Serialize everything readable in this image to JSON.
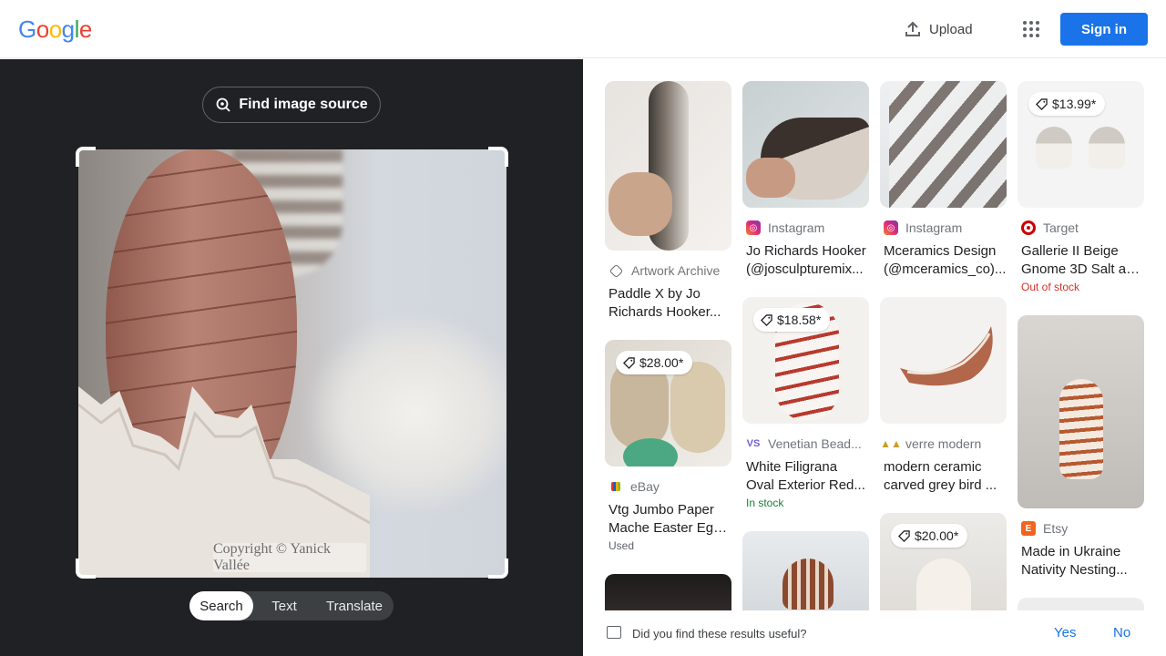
{
  "header": {
    "logo_letters": [
      {
        "ch": "G",
        "color": "#4285F4"
      },
      {
        "ch": "o",
        "color": "#EA4335"
      },
      {
        "ch": "o",
        "color": "#FBBC05"
      },
      {
        "ch": "g",
        "color": "#4285F4"
      },
      {
        "ch": "l",
        "color": "#34A853"
      },
      {
        "ch": "e",
        "color": "#EA4335"
      }
    ],
    "upload_label": "Upload",
    "apps_icon": "apps-grid-icon",
    "signin_label": "Sign in",
    "signin_color": "#1a73e8"
  },
  "lens": {
    "find_source_label": "Find image source",
    "watermark": "Copyright © Yanick Vallée",
    "modes": [
      "Search",
      "Text",
      "Translate"
    ],
    "active_mode": "Search"
  },
  "results": {
    "columns": [
      [
        {
          "source": "Artwork Archive",
          "source_icon": "artwork-archive-icon",
          "title_lines": [
            "Paddle X by Jo",
            "Richards Hooker..."
          ]
        },
        {
          "price": "$28.00*",
          "source": "eBay",
          "source_icon": "ebay-icon",
          "title_lines": [
            "Vtg Jumbo Paper",
            "Mache Easter Egg..."
          ],
          "status": "Used",
          "status_color": "#5f6368"
        }
      ],
      [
        {
          "source": "Instagram",
          "source_icon": "instagram-icon",
          "title_lines": [
            "Jo Richards Hooker",
            "(@josculpturemix..."
          ]
        },
        {
          "price": "$18.58*",
          "source": "Venetian Bead...",
          "source_icon": "venetian-bead-icon",
          "title_lines": [
            "White Filigrana",
            "Oval Exterior Red..."
          ],
          "status": "In stock",
          "status_color": "#188038"
        }
      ],
      [
        {
          "source": "Instagram",
          "source_icon": "instagram-icon",
          "title_lines": [
            "Mceramics Design",
            "(@mceramics_co)..."
          ]
        },
        {
          "source": "verre modern",
          "source_icon": "verre-modern-icon",
          "title_lines": [
            "modern ceramic",
            "carved grey bird ..."
          ]
        },
        {
          "price": "$20.00*"
        }
      ],
      [
        {
          "price": "$13.99*",
          "source": "Target",
          "source_icon": "target-icon",
          "title_lines": [
            "Gallerie II Beige",
            "Gnome 3D Salt an..."
          ],
          "status": "Out of stock",
          "status_color": "#d93025"
        },
        {
          "source": "Etsy",
          "source_icon": "etsy-icon",
          "title_lines": [
            "Made in Ukraine",
            "Nativity Nesting..."
          ]
        }
      ]
    ]
  },
  "feedback": {
    "question": "Did you find these results useful?",
    "yes": "Yes",
    "no": "No"
  }
}
